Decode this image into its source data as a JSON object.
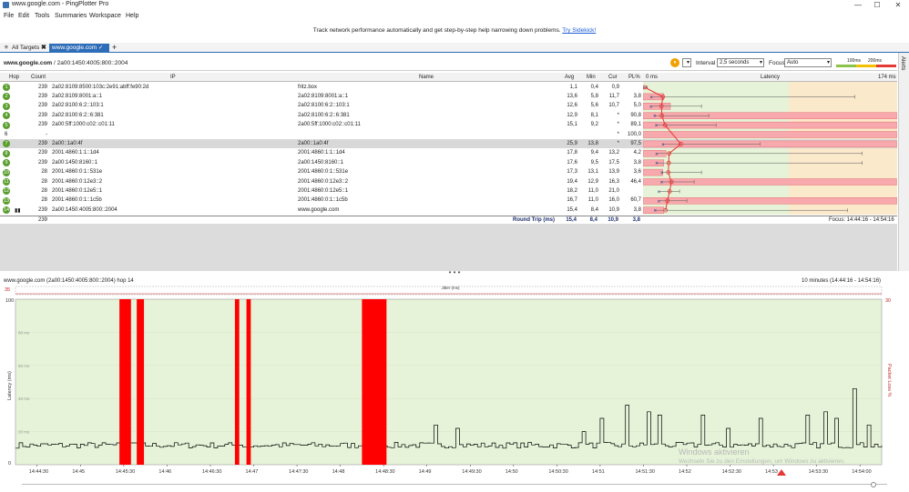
{
  "window": {
    "title": "www.google.com - PingPlotter Pro",
    "min": "—",
    "max": "☐",
    "close": "✕"
  },
  "menu": [
    "File",
    "Edit",
    "Tools",
    "Summaries",
    "Workspace",
    "Help"
  ],
  "banner": {
    "text": "Track network performance automatically and get step-by-step help narrowing down problems.",
    "link": "Try Sidekick!"
  },
  "tabs": {
    "all_targets": "All Targets",
    "active": "www.google.com",
    "add": "+"
  },
  "toolbar": {
    "target": "www.google.com",
    "path_rest": "/ 2a00:1450:4005:800::2004",
    "interval_label": "Interval",
    "interval_value": "2,5 seconds",
    "focus_label": "Focus",
    "focus_value": "Auto",
    "thresholds": [
      "100ms",
      "200ms"
    ]
  },
  "alerts_label": "Alerts",
  "columns": {
    "hop": "Hop",
    "count": "Count",
    "ip": "IP",
    "name": "Name",
    "avg": "Avg",
    "min": "Min",
    "cur": "Cur",
    "pl": "PL%",
    "zero": "0 ms",
    "latency": "Latency",
    "max": "174 ms"
  },
  "hops": [
    {
      "hop": "1",
      "count": "239",
      "ip": "2a02:8109:8500:103c:2e91:abff:fe90:2d",
      "name": "fritz.box",
      "avg": "1,1",
      "min": "0,4",
      "cur": "0,9",
      "pl": "",
      "status": "green",
      "avg_ms": 1.1,
      "min_ms": 0.4,
      "max_ms": 3,
      "pl_pct": 0
    },
    {
      "hop": "2",
      "count": "239",
      "ip": "2a02:8109:8001:a::1",
      "name": "2a02:8109:8001:a::1",
      "avg": "13,6",
      "min": "5,8",
      "cur": "11,7",
      "pl": "3,8",
      "status": "green",
      "avg_ms": 13.6,
      "min_ms": 5.8,
      "max_ms": 145,
      "pl_pct": 3.8
    },
    {
      "hop": "3",
      "count": "239",
      "ip": "2a02:8100:6:2::103:1",
      "name": "2a02:8100:6:2::103:1",
      "avg": "12,6",
      "min": "5,6",
      "cur": "10,7",
      "pl": "5,0",
      "status": "green",
      "avg_ms": 12.6,
      "min_ms": 5.6,
      "max_ms": 40,
      "pl_pct": 5.0
    },
    {
      "hop": "4",
      "count": "239",
      "ip": "2a02:8100:6:2::6:381",
      "name": "2a02:8100:6:2::6:381",
      "avg": "12,9",
      "min": "8,1",
      "cur": "*",
      "pl": "90,8",
      "status": "green",
      "avg_ms": 12.9,
      "min_ms": 8.1,
      "max_ms": 45,
      "pl_pct": 90.8
    },
    {
      "hop": "5",
      "count": "239",
      "ip": "2a00:5ff:1000:c02::c01:11",
      "name": "2a00:5ff:1000:c02::c01:11",
      "avg": "15,1",
      "min": "9,2",
      "cur": "*",
      "pl": "89,1",
      "status": "green",
      "avg_ms": 15.1,
      "min_ms": 9.2,
      "max_ms": 50,
      "pl_pct": 89.1
    },
    {
      "hop": "6",
      "count": "-",
      "ip": "",
      "name": "",
      "avg": "",
      "min": "",
      "cur": "*",
      "pl": "100,0",
      "status": "none",
      "avg_ms": null,
      "min_ms": null,
      "max_ms": null,
      "pl_pct": 100
    },
    {
      "hop": "7",
      "count": "239",
      "ip": "2a00::1a0:4f",
      "name": "2a00::1a0:4f",
      "avg": "25,9",
      "min": "13,8",
      "cur": "*",
      "pl": "97,5",
      "status": "green",
      "avg_ms": 25.9,
      "min_ms": 13.8,
      "max_ms": 80,
      "pl_pct": 97.5
    },
    {
      "hop": "8",
      "count": "239",
      "ip": "2001:4860:1:1::1d4",
      "name": "2001:4860:1:1::1d4",
      "avg": "17,8",
      "min": "9,4",
      "cur": "13,2",
      "pl": "4,2",
      "status": "green",
      "avg_ms": 17.8,
      "min_ms": 9.4,
      "max_ms": 150,
      "pl_pct": 4.2
    },
    {
      "hop": "9",
      "count": "239",
      "ip": "2a00:1450:8160::1",
      "name": "2a00:1450:8160::1",
      "avg": "17,6",
      "min": "9,5",
      "cur": "17,5",
      "pl": "3,8",
      "status": "green",
      "avg_ms": 17.6,
      "min_ms": 9.5,
      "max_ms": 150,
      "pl_pct": 3.8
    },
    {
      "hop": "10",
      "count": "28",
      "ip": "2001:4860:0:1::531e",
      "name": "2001:4860:0:1::531e",
      "avg": "17,3",
      "min": "13,1",
      "cur": "13,9",
      "pl": "3,6",
      "status": "green",
      "avg_ms": 17.3,
      "min_ms": 13.1,
      "max_ms": 40,
      "pl_pct": 3.6
    },
    {
      "hop": "11",
      "count": "28",
      "ip": "2001:4860:0:12e3::2",
      "name": "2001:4860:0:12e3::2",
      "avg": "19,4",
      "min": "12,9",
      "cur": "16,3",
      "pl": "46,4",
      "status": "green",
      "avg_ms": 19.4,
      "min_ms": 12.9,
      "max_ms": 35,
      "pl_pct": 46.4
    },
    {
      "hop": "12",
      "count": "28",
      "ip": "2001:4860:0:12e5::1",
      "name": "2001:4860:0:12e5::1",
      "avg": "18,2",
      "min": "11,0",
      "cur": "21,0",
      "pl": "",
      "status": "green",
      "avg_ms": 18.2,
      "min_ms": 11.0,
      "max_ms": 25,
      "pl_pct": 0
    },
    {
      "hop": "13",
      "count": "28",
      "ip": "2001:4860:0:1::1c5b",
      "name": "2001:4860:0:1::1c5b",
      "avg": "16,7",
      "min": "11,0",
      "cur": "16,0",
      "pl": "60,7",
      "status": "green",
      "avg_ms": 16.7,
      "min_ms": 11.0,
      "max_ms": 30,
      "pl_pct": 60.7
    },
    {
      "hop": "14",
      "count": "239",
      "ip": "2a00:1450:4005:800::2004",
      "name": "www.google.com",
      "avg": "15,4",
      "min": "8,4",
      "cur": "10,9",
      "pl": "3,8",
      "status": "green",
      "avg_ms": 15.4,
      "min_ms": 8.4,
      "max_ms": 140,
      "pl_pct": 3.8
    }
  ],
  "footer": {
    "count": "239",
    "label": "Round Trip (ms)",
    "avg": "15,4",
    "min": "8,4",
    "cur": "10,9",
    "pl": "3,8",
    "focus_range": "Focus: 14:44:16 - 14:54:16"
  },
  "graph": {
    "title": "www.google.com (2a00:1450:4005:800::2004) hop 14",
    "range": "10 minutes (14:44:16 - 14:54:16)",
    "jitter_label": "Jitter (ms)",
    "jitter_top": "35",
    "pl_top": "30",
    "ylabel": "Latency (ms)",
    "y2label": "Packet Loss %",
    "y_top": "100",
    "y_zero": "0",
    "y_ticks": [
      "80 ms",
      "60 ms",
      "40 ms",
      "20 ms"
    ],
    "x_ticks": [
      "14:44:30",
      "14:45",
      "14:45:30",
      "14:46",
      "14:46:30",
      "14:47",
      "14:47:30",
      "14:48",
      "14:48:30",
      "14:49",
      "14:49:30",
      "14:50",
      "14:50:30",
      "14:51",
      "14:51:30",
      "14:52",
      "14:52:30",
      "14:53",
      "14:53:30",
      "14:54:00"
    ],
    "x_start_sec": 0,
    "x_end_sec": 600,
    "loss_bars": [
      [
        72,
        80,
        100
      ],
      [
        84,
        89,
        100
      ],
      [
        152,
        155,
        100
      ],
      [
        160,
        163,
        100
      ],
      [
        240,
        257,
        100
      ]
    ],
    "spikes": [
      [
        81,
        60
      ],
      [
        88,
        70
      ],
      [
        153,
        75
      ],
      [
        161,
        72
      ],
      [
        290,
        24
      ],
      [
        305,
        22
      ],
      [
        392,
        20
      ],
      [
        405,
        28
      ],
      [
        422,
        36
      ],
      [
        437,
        32
      ],
      [
        446,
        30
      ],
      [
        476,
        30
      ],
      [
        493,
        22
      ],
      [
        516,
        28
      ],
      [
        548,
        30
      ],
      [
        560,
        32
      ],
      [
        567,
        28
      ],
      [
        581,
        46
      ],
      [
        591,
        24
      ]
    ],
    "colors": {
      "good": "#e6f3d8",
      "loss": "#ff0000",
      "line": "#000000",
      "axis": "#333333"
    }
  },
  "watermark": {
    "line1": "Windows aktivieren",
    "line2": "Wechseln Sie zu den Einstellungen, um Windows zu aktivieren."
  }
}
